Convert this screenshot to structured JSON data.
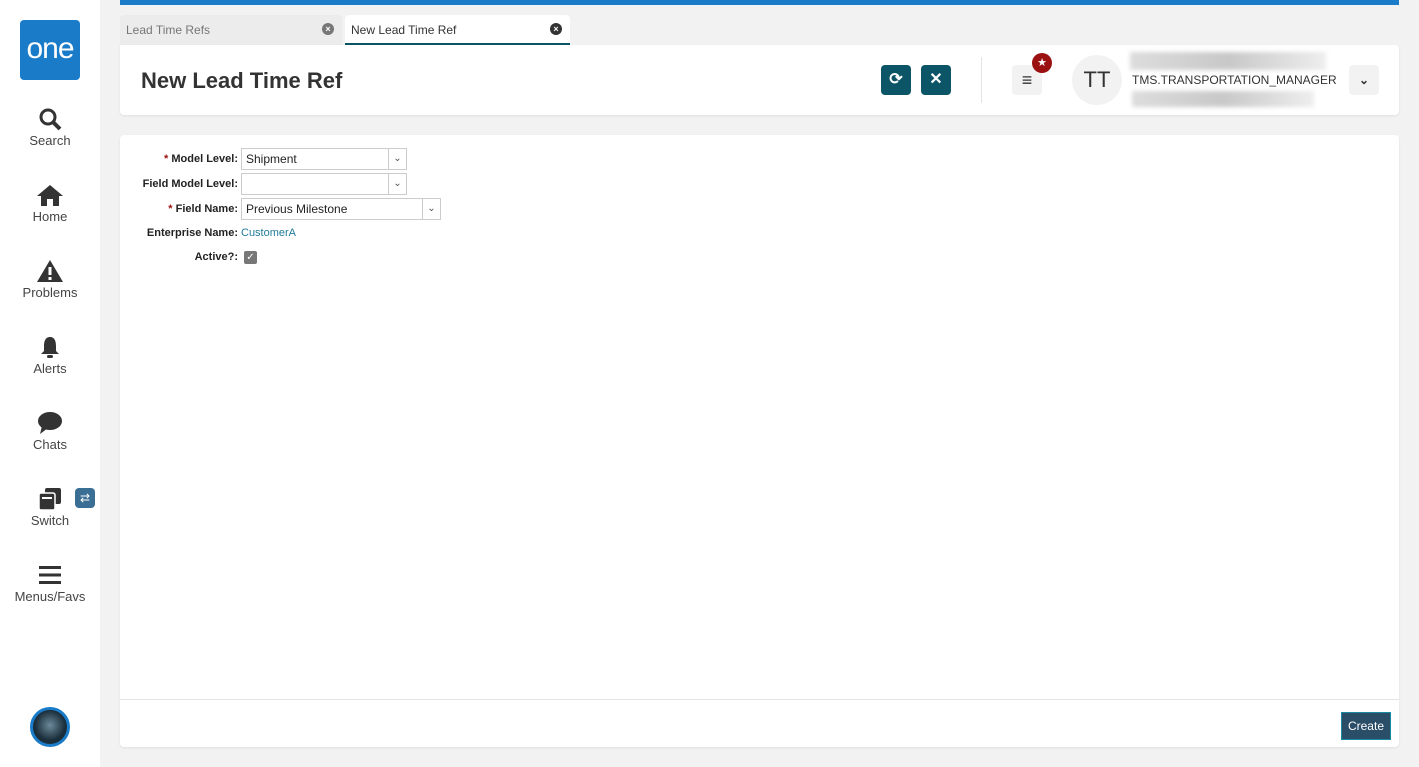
{
  "sidebar": {
    "logo": "one",
    "items": [
      {
        "label": "Search"
      },
      {
        "label": "Home"
      },
      {
        "label": "Problems"
      },
      {
        "label": "Alerts"
      },
      {
        "label": "Chats"
      },
      {
        "label": "Switch"
      },
      {
        "label": "Menus/Favs"
      }
    ]
  },
  "tabs": [
    {
      "label": "Lead Time Refs"
    },
    {
      "label": "New Lead Time Ref"
    }
  ],
  "header": {
    "title": "New Lead Time Ref",
    "avatar_initials": "TT",
    "role": "TMS.TRANSPORTATION_MANAGER"
  },
  "form": {
    "model_level": {
      "label": "Model Level:",
      "value": "Shipment"
    },
    "field_model_level": {
      "label": "Field Model Level:",
      "value": ""
    },
    "field_name": {
      "label": "Field Name:",
      "value": "Previous Milestone"
    },
    "enterprise_name": {
      "label": "Enterprise Name:",
      "value": "CustomerA"
    },
    "active": {
      "label": "Active?:",
      "checked": true
    }
  },
  "footer": {
    "create_label": "Create"
  },
  "colors": {
    "brand": "#1a7bc9",
    "accent": "#0b5566",
    "badge": "#9b1010"
  }
}
